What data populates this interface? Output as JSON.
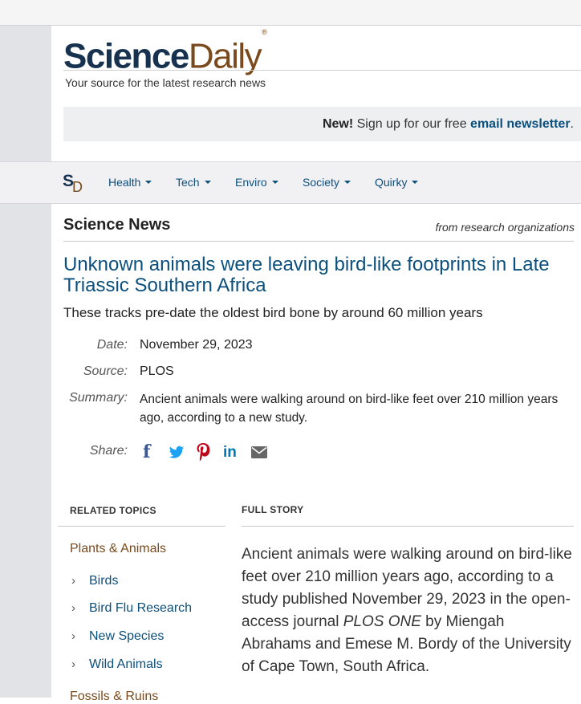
{
  "header": {
    "logo_science": "Science",
    "logo_daily": "Daily",
    "logo_reg": "®",
    "tagline": "Your source for the latest research news",
    "newsletter_new": "New!",
    "newsletter_text": " Sign up for our free ",
    "newsletter_link": "email newsletter",
    "newsletter_end": "."
  },
  "nav": {
    "logo_s": "S",
    "logo_d": "D",
    "items": [
      {
        "label": "Health"
      },
      {
        "label": "Tech"
      },
      {
        "label": "Enviro"
      },
      {
        "label": "Society"
      },
      {
        "label": "Quirky"
      }
    ]
  },
  "section": {
    "title": "Science News",
    "subtitle": "from research organizations"
  },
  "article": {
    "headline": "Unknown animals were leaving bird-like footprints in Late Triassic Southern Africa",
    "subheadline": "These tracks pre-date the oldest bird bone by around 60 million years",
    "date_label": "Date:",
    "date": "November 29, 2023",
    "source_label": "Source:",
    "source": "PLOS",
    "summary_label": "Summary:",
    "summary": "Ancient animals were walking around on bird-like feet over 210 million years ago, according to a new study.",
    "share_label": "Share:",
    "share_icons": [
      "facebook-icon",
      "twitter-icon",
      "pinterest-icon",
      "linkedin-icon",
      "email-icon"
    ],
    "share_in_text": "in"
  },
  "related": {
    "heading": "RELATED TOPICS",
    "category1": "Plants & Animals",
    "items": [
      {
        "label": "Birds"
      },
      {
        "label": "Bird Flu Research"
      },
      {
        "label": "New Species"
      },
      {
        "label": "Wild Animals"
      }
    ],
    "category2": "Fossils & Ruins",
    "chevron": "›"
  },
  "full_story": {
    "heading": "FULL STORY",
    "text_before": "Ancient animals were walking around on bird-like feet over 210 million years ago, according to a study published November 29, 2023 in the open-access journal ",
    "journal": "PLOS ONE",
    "text_after": " by Miengah Abrahams and Emese M. Bordy of the University of Cape Town, South Africa."
  },
  "colors": {
    "brand_navy": "#16324f",
    "brand_brown": "#7a4a1c",
    "link_blue": "#0b4f7c",
    "gutter_gray": "#e2e3e7"
  }
}
